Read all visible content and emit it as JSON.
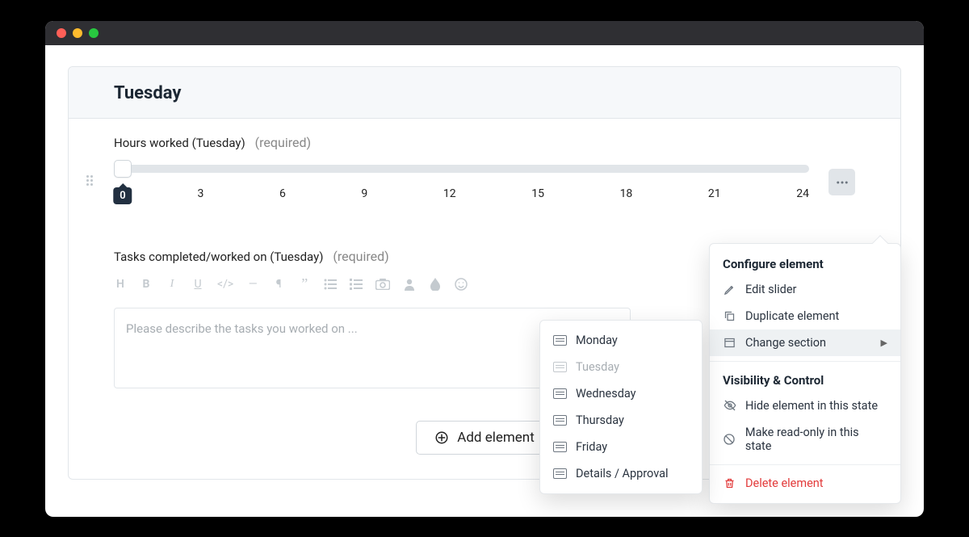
{
  "section_title": "Tuesday",
  "slider": {
    "label": "Hours worked (Tuesday)",
    "required_text": "(required)",
    "value": "0",
    "ticks": [
      "0",
      "3",
      "6",
      "9",
      "12",
      "15",
      "18",
      "21",
      "24"
    ]
  },
  "tasks": {
    "label": "Tasks completed/worked on (Tuesday)",
    "required_text": "(required)",
    "placeholder": "Please describe the tasks you worked on ..."
  },
  "add_button": "Add element",
  "config_menu": {
    "group1_title": "Configure element",
    "edit": "Edit slider",
    "duplicate": "Duplicate element",
    "change_section": "Change section",
    "group2_title": "Visibility & Control",
    "hide": "Hide element in this state",
    "readonly": "Make read-only in this state",
    "delete": "Delete element"
  },
  "sections_menu": {
    "items": [
      {
        "label": "Monday",
        "current": false
      },
      {
        "label": "Tuesday",
        "current": true
      },
      {
        "label": "Wednesday",
        "current": false
      },
      {
        "label": "Thursday",
        "current": false
      },
      {
        "label": "Friday",
        "current": false
      },
      {
        "label": "Details / Approval",
        "current": false
      }
    ]
  }
}
